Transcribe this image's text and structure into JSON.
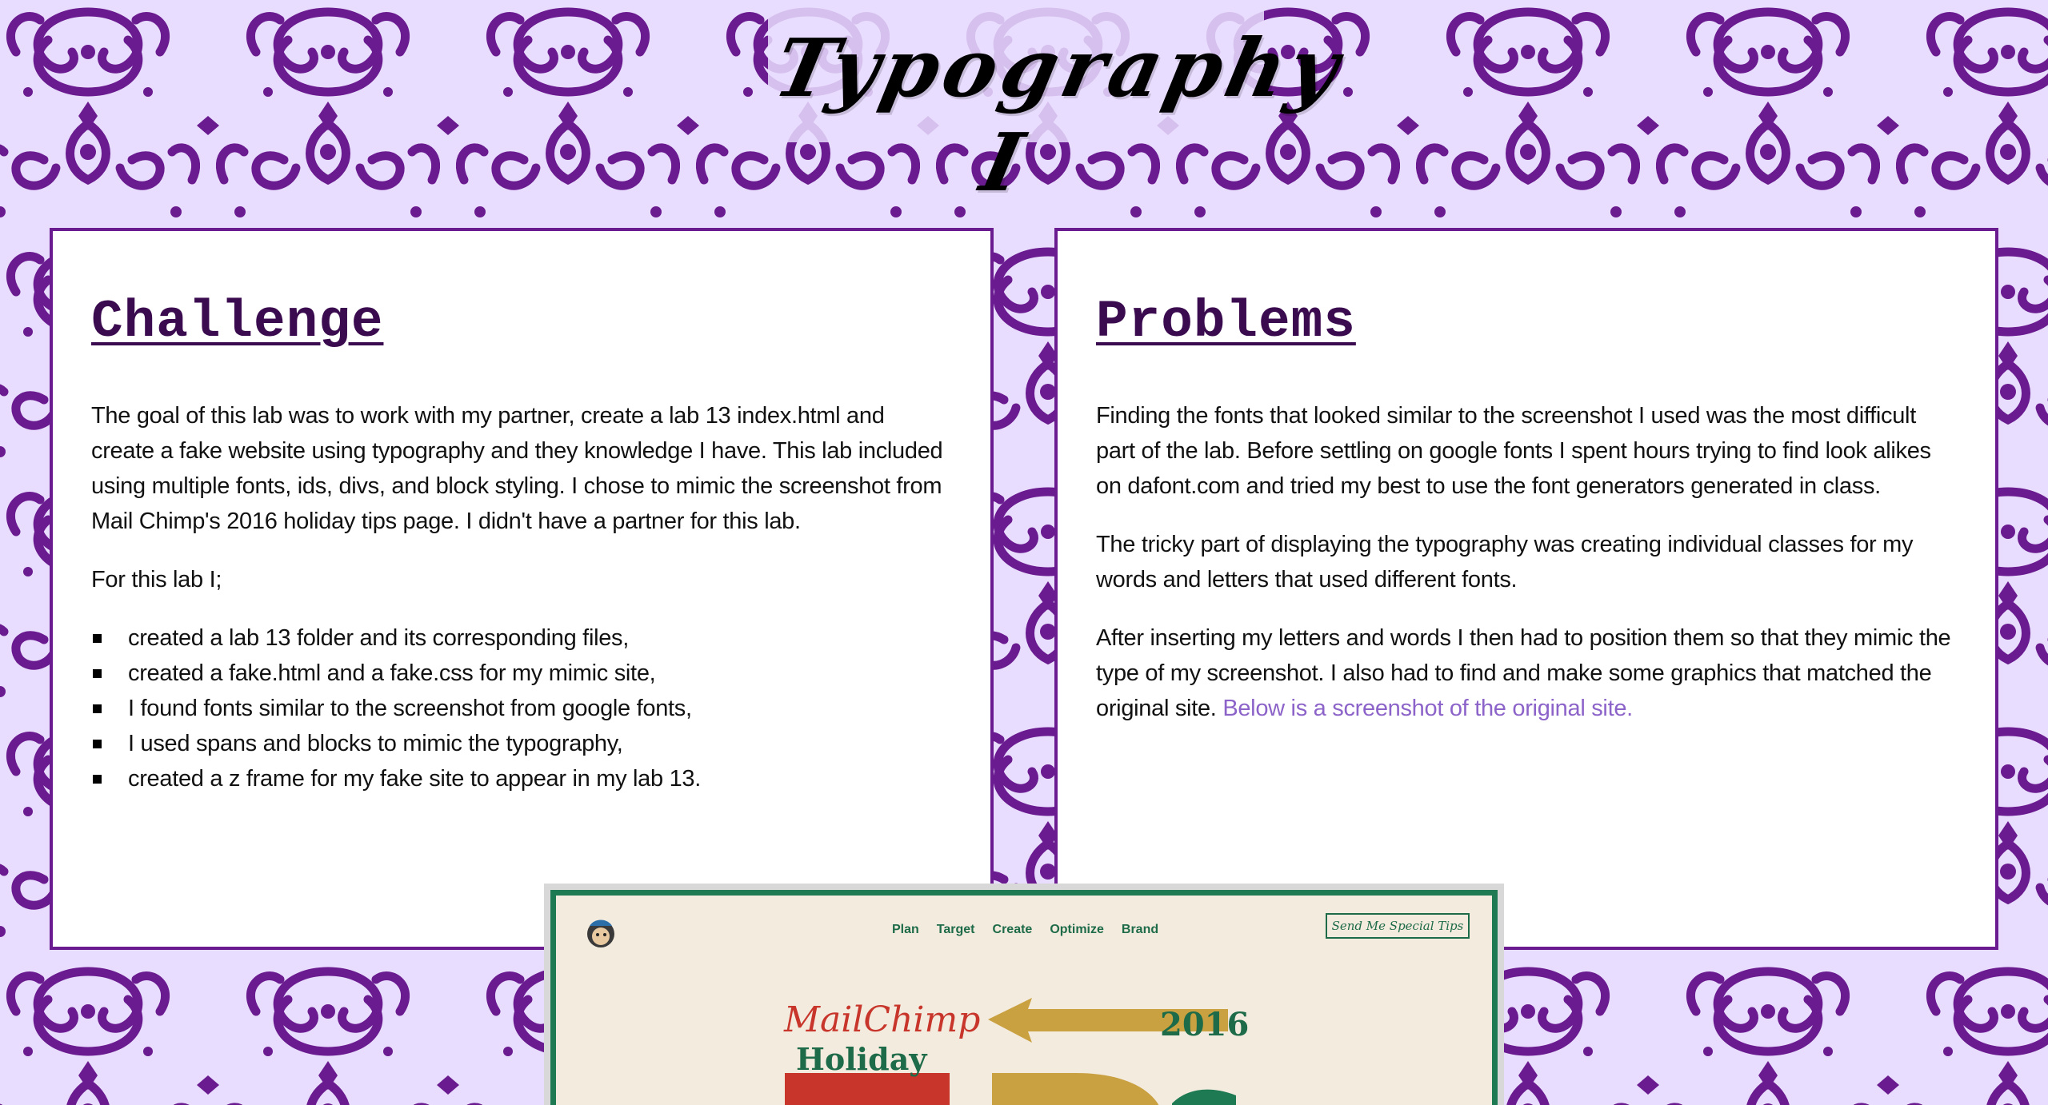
{
  "page": {
    "title": "Typography I"
  },
  "challenge": {
    "heading": "Challenge",
    "intro": "The goal of this lab was to work with my partner, create a lab 13 index.html and create a fake website using typography and they knowledge I have. This lab included using multiple fonts, ids, divs, and block styling. I chose to mimic the screenshot from Mail Chimp's 2016 holiday tips page. I didn't have a partner for this lab.",
    "list_intro": "For this lab I;",
    "items": [
      "created a lab 13 folder and its corresponding files,",
      "created a fake.html and a fake.css for my mimic site,",
      "I found fonts similar to the screenshot from google fonts,",
      "I used spans and blocks to mimic the typography,",
      "created a z frame for my fake site to appear in my lab 13."
    ]
  },
  "problems": {
    "heading": "Problems",
    "p1": "Finding the fonts that looked similar to the screenshot I used was the most difficult part of the lab. Before settling on google fonts I spent hours trying to find look alikes on dafont.com and tried my best to use the font generators generated in class.",
    "p2": "The tricky part of displaying the typography was creating individual classes for my words and letters that used different fonts.",
    "p3": "After inserting my letters and words I then had to position them so that they mimic the type of my screenshot. I also had to find and make some graphics that matched the original site.",
    "link": "Below is a screenshot of the original site."
  },
  "preview": {
    "nav": [
      "Plan",
      "Target",
      "Create",
      "Optimize",
      "Brand"
    ],
    "cta": "Send Me Special Tips",
    "brand": "MailChimp",
    "holiday": "Holiday",
    "year": "2016"
  },
  "colors": {
    "background": "#e9ddff",
    "damask": "#6a1b8f",
    "panel_border": "#6a1b8f",
    "heading": "#3a0b4e",
    "link": "#8c63c9",
    "mc_green": "#1d6b48",
    "mc_red": "#c7352b",
    "mc_gold": "#c9a141",
    "mc_cream": "#f4ebdf"
  }
}
